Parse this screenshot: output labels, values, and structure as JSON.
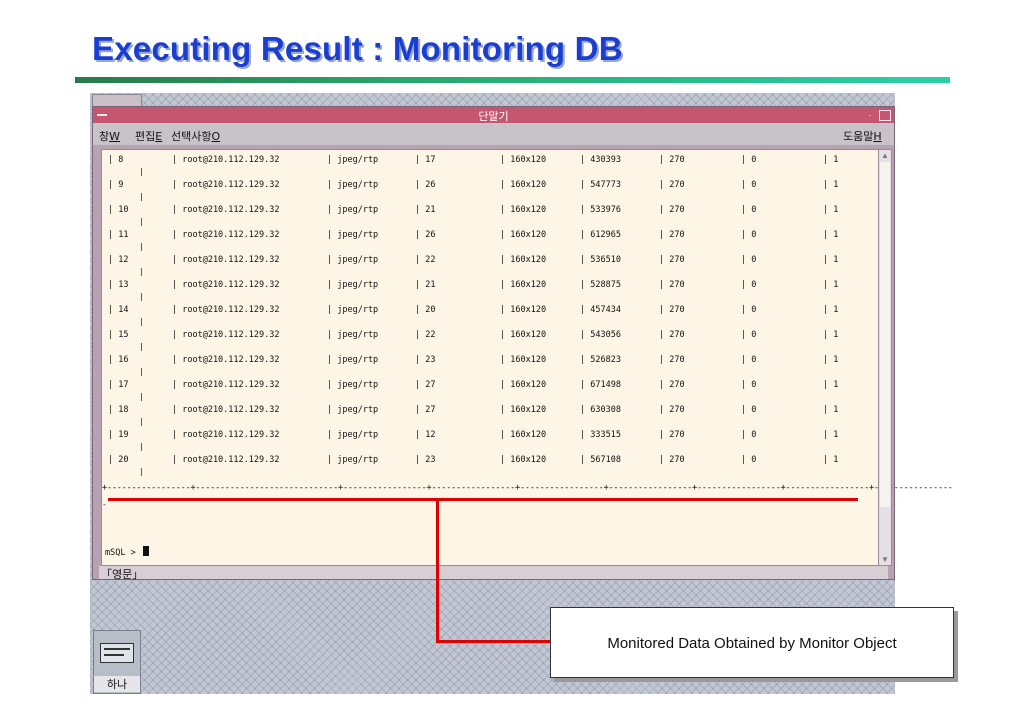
{
  "slide": {
    "title": "Executing Result : Monitoring DB"
  },
  "window": {
    "title": "단말기",
    "menu": {
      "window": "창",
      "window_key": "W",
      "edit": "편집",
      "edit_key": "E",
      "options": "선택사항",
      "options_key": "O",
      "help": "도움말",
      "help_key": "H"
    },
    "minimize_glyph": "·"
  },
  "table": {
    "rows": [
      [
        "8",
        "root@210.112.129.32",
        "jpeg/rtp",
        "17",
        "160x120",
        "430393",
        "270",
        "0",
        "1"
      ],
      [
        "9",
        "root@210.112.129.32",
        "jpeg/rtp",
        "26",
        "160x120",
        "547773",
        "270",
        "0",
        "1"
      ],
      [
        "10",
        "root@210.112.129.32",
        "jpeg/rtp",
        "21",
        "160x120",
        "533976",
        "270",
        "0",
        "1"
      ],
      [
        "11",
        "root@210.112.129.32",
        "jpeg/rtp",
        "26",
        "160x120",
        "612965",
        "270",
        "0",
        "1"
      ],
      [
        "12",
        "root@210.112.129.32",
        "jpeg/rtp",
        "22",
        "160x120",
        "536510",
        "270",
        "0",
        "1"
      ],
      [
        "13",
        "root@210.112.129.32",
        "jpeg/rtp",
        "21",
        "160x120",
        "528875",
        "270",
        "0",
        "1"
      ],
      [
        "14",
        "root@210.112.129.32",
        "jpeg/rtp",
        "20",
        "160x120",
        "457434",
        "270",
        "0",
        "1"
      ],
      [
        "15",
        "root@210.112.129.32",
        "jpeg/rtp",
        "22",
        "160x120",
        "543056",
        "270",
        "0",
        "1"
      ],
      [
        "16",
        "root@210.112.129.32",
        "jpeg/rtp",
        "23",
        "160x120",
        "526823",
        "270",
        "0",
        "1"
      ],
      [
        "17",
        "root@210.112.129.32",
        "jpeg/rtp",
        "27",
        "160x120",
        "671498",
        "270",
        "0",
        "1"
      ],
      [
        "18",
        "root@210.112.129.32",
        "jpeg/rtp",
        "27",
        "160x120",
        "630308",
        "270",
        "0",
        "1"
      ],
      [
        "19",
        "root@210.112.129.32",
        "jpeg/rtp",
        "12",
        "160x120",
        "333515",
        "270",
        "0",
        "1"
      ],
      [
        "20",
        "root@210.112.129.32",
        "jpeg/rtp",
        "23",
        "160x120",
        "567108",
        "270",
        "0",
        "1"
      ]
    ],
    "separator": "+-----------------+-----------------------------+-----------------+-----------------+-----------------+-----------------+-----------------+-----------------+----------------",
    "dash": "-"
  },
  "prompt": {
    "text": "mSQL > "
  },
  "statusbar": {
    "input_mode": "「영문」"
  },
  "callout": {
    "text": "Monitored Data Obtained by Monitor Object"
  },
  "desktop_icon": {
    "label": "하나"
  },
  "colors": {
    "accent": "#1a3fd0",
    "titlebar": "#c4566f",
    "terminal_bg": "#fdf5e6",
    "annotation": "#e00000"
  }
}
